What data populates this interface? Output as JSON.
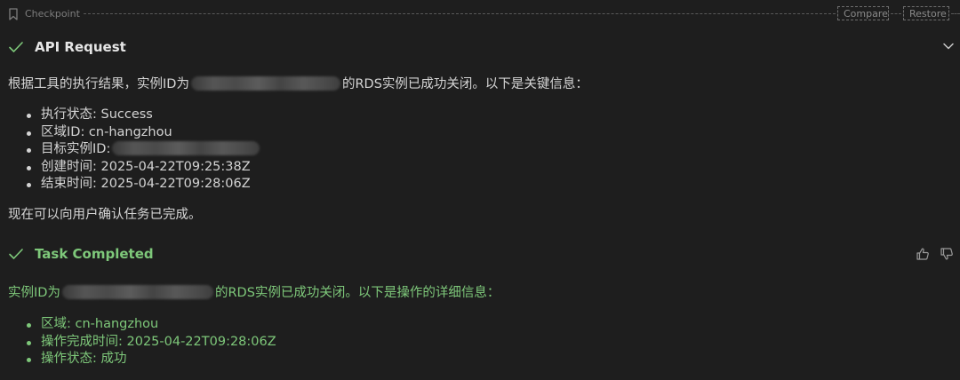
{
  "checkpoint": {
    "label": "Checkpoint",
    "compare_label": "Compare",
    "restore_label": "Restore"
  },
  "api_request": {
    "title": "API Request",
    "intro_prefix": "根据工具的执行结果，实例ID为",
    "intro_suffix": "的RDS实例已成功关闭。以下是关键信息：",
    "items": [
      "执行状态: Success",
      "区域ID: cn-hangzhou",
      "目标实例ID:",
      "创建时间: 2025-04-22T09:25:38Z",
      "结束时间: 2025-04-22T09:28:06Z"
    ],
    "footer": "现在可以向用户确认任务已完成。"
  },
  "task_completed": {
    "title": "Task Completed",
    "intro_prefix": "实例ID为",
    "intro_suffix": "的RDS实例已成功关闭。以下是操作的详细信息：",
    "items": [
      "区域: cn-hangzhou",
      "操作完成时间: 2025-04-22T09:28:06Z",
      "操作状态: 成功"
    ]
  },
  "colors": {
    "background": "#1e1e1e",
    "text": "#d4d4d4",
    "accent_green": "#7ec87a",
    "muted": "#7d7d7d"
  },
  "icons": {
    "checkpoint": "bookmark-icon",
    "check": "check-icon",
    "collapse": "chevron-down-icon",
    "feedback_up": "thumbs-up-icon",
    "feedback_down": "thumbs-down-icon"
  }
}
